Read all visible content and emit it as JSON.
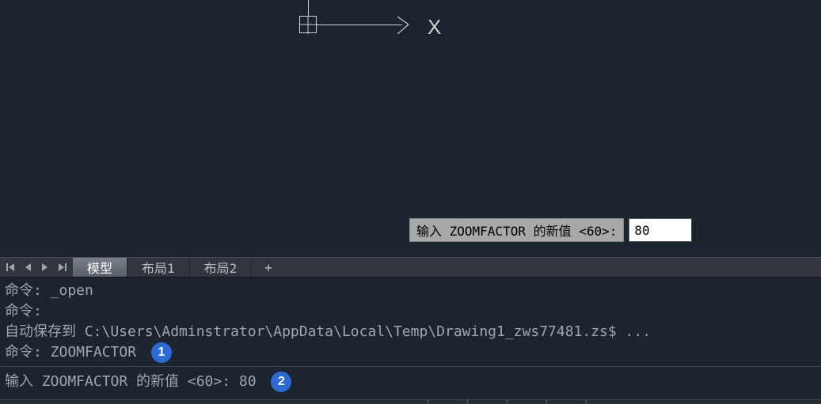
{
  "drawing": {
    "x_label": "X"
  },
  "tooltip": {
    "prompt": "输入 ZOOMFACTOR 的新值 <60>:",
    "value": "80"
  },
  "tabs": {
    "model": "模型",
    "layout1": "布局1",
    "layout2": "布局2",
    "plus": "+"
  },
  "command_log": {
    "line1": "命令: _open",
    "line2": "命令:",
    "line3": "自动保存到 C:\\Users\\Adminstrator\\AppData\\Local\\Temp\\Drawing1_zws77481.zs$ ...",
    "line4": "命令: ZOOMFACTOR",
    "badge1": "1"
  },
  "command_input": {
    "text": "输入 ZOOMFACTOR 的新值 <60>: 80",
    "badge2": "2"
  }
}
